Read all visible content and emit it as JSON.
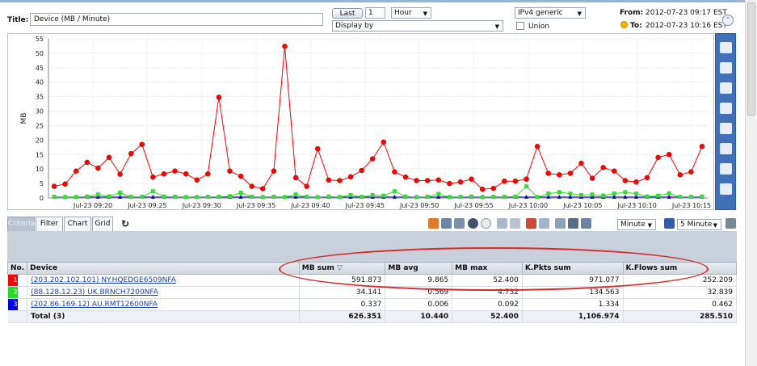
{
  "header": {
    "title_label": "Title:",
    "title_value": "Device (MB / Minute)",
    "last_button": "Last",
    "last_count": "1",
    "period": "Hour",
    "display_by": "Display by",
    "ip_version": "IPv4 generic",
    "union_label": "Union",
    "from_label": "From:",
    "from_value": "2012-07-23 09:17 EST",
    "to_label": "To:",
    "to_value": "2012-07-23 10:16 EST"
  },
  "chart_data": {
    "type": "line",
    "ylabel": "MB",
    "xlabel": "",
    "ylim": [
      0,
      55
    ],
    "yticks": [
      0,
      5,
      10,
      15,
      20,
      25,
      30,
      35,
      40,
      45,
      50,
      55
    ],
    "xticks": [
      "Jul-23 09:20",
      "Jul-23 09:25",
      "Jul-23 09:30",
      "Jul-23 09:35",
      "Jul-23 09:40",
      "Jul-23 09:45",
      "Jul-23 09:50",
      "Jul-23 09:55",
      "Jul-23 10:00",
      "Jul-23 10:05",
      "Jul-23 10:10",
      "Jul-23 10:15"
    ],
    "grid": true,
    "series": [
      {
        "color": "#ff0000",
        "marker": "circle",
        "values": [
          4,
          4.8,
          9.3,
          12.3,
          10.3,
          14,
          8.2,
          15.3,
          18.5,
          7.2,
          8.3,
          9.3,
          8.3,
          6.2,
          8.3,
          34.8,
          9.3,
          7.5,
          4,
          3.2,
          9.3,
          52.4,
          7,
          4,
          17,
          6.2,
          6,
          7.3,
          9.5,
          13.5,
          19.3,
          9,
          7.2,
          6,
          6,
          6.2,
          5,
          5.5,
          6.5,
          3,
          3.3,
          5.8,
          5.8,
          6.5,
          17.8,
          8.5,
          8,
          8.5,
          12,
          6.8,
          10.5,
          9.3,
          6,
          5.5,
          7,
          14,
          15,
          8,
          9,
          17.8
        ]
      },
      {
        "color": "#33dd33",
        "marker": "square",
        "values": [
          0.4,
          0.3,
          0.3,
          0.5,
          1.2,
          0.6,
          1.8,
          0.4,
          0.4,
          2.3,
          0.5,
          0.4,
          0.3,
          0.3,
          0.4,
          0.4,
          0.6,
          1.8,
          0.4,
          0.3,
          0.4,
          0.3,
          1.2,
          0.4,
          0.3,
          0.5,
          0.3,
          1,
          0.4,
          1,
          0.8,
          2.3,
          0.5,
          0.3,
          0.4,
          1.4,
          0.3,
          0.4,
          0.5,
          0.3,
          0.4,
          0.4,
          0.5,
          4,
          0.3,
          1.5,
          2,
          1.5,
          1,
          1.2,
          0.8,
          1.5,
          2,
          1.5,
          0.5,
          0.8,
          1.6,
          0.4,
          0.4,
          0.5
        ]
      },
      {
        "color": "#0000cc",
        "marker": "triangle",
        "values": [
          0.3,
          0.3,
          0.3,
          0.3,
          0.3,
          0.3,
          0.3,
          0.3,
          0.3,
          0.3,
          0.3,
          0.3,
          0.3,
          0.3,
          0.3,
          0.3,
          0.3,
          0.3,
          0.3,
          0.3,
          0.3,
          0.3,
          0.3,
          0.3,
          0.3,
          0.3,
          0.3,
          0.3,
          0.3,
          0.3,
          0.3,
          0.3,
          0.3,
          0.3,
          0.3,
          0.3,
          0.3,
          0.3,
          0.3,
          0.3,
          0.3,
          0.3,
          0.3,
          0.3,
          0.3,
          0.3,
          0.3,
          0.3,
          0.3,
          0.3,
          0.3,
          0.3,
          0.3,
          0.3,
          0.3,
          0.3,
          0.3,
          0.3,
          0.3,
          0.3
        ]
      }
    ]
  },
  "tabs": [
    {
      "label": "Criteria",
      "active": true
    },
    {
      "label": "Filter",
      "active": false
    },
    {
      "label": "Chart",
      "active": false
    },
    {
      "label": "Grid",
      "active": false
    }
  ],
  "toolbar": {
    "granularity": "Minute",
    "interval": "5 Minute"
  },
  "table": {
    "headers": [
      "No.",
      "Device",
      "MB sum",
      "MB avg",
      "MB max",
      "K.Pkts sum",
      "K.Flows sum"
    ],
    "sort_glyph": "▽",
    "rows": [
      {
        "no": "1",
        "color": "#ff0000",
        "device": "(203.202.102.101) NY.HQEDGE6509NFA",
        "mb_sum": "591.873",
        "mb_avg": "9.865",
        "mb_max": "52.400",
        "kpkts": "971.077",
        "kflows": "252.209"
      },
      {
        "no": "2",
        "color": "#22dd22",
        "device": "(88.128.12.23) UK.BRNCH7200NFA",
        "mb_sum": "34.141",
        "mb_avg": "0.569",
        "mb_max": "4.732",
        "kpkts": "134.563",
        "kflows": "32.839"
      },
      {
        "no": "3",
        "color": "#0000ee",
        "device": "(202.86.169.12) AU.RMT12600NFA",
        "mb_sum": "0.337",
        "mb_avg": "0.006",
        "mb_max": "0.092",
        "kpkts": "1.334",
        "kflows": "0.462"
      }
    ],
    "total": {
      "label": "Total (3)",
      "mb_sum": "626.351",
      "mb_avg": "10.440",
      "mb_max": "52.400",
      "kpkts": "1,106.974",
      "kflows": "285.510"
    }
  }
}
